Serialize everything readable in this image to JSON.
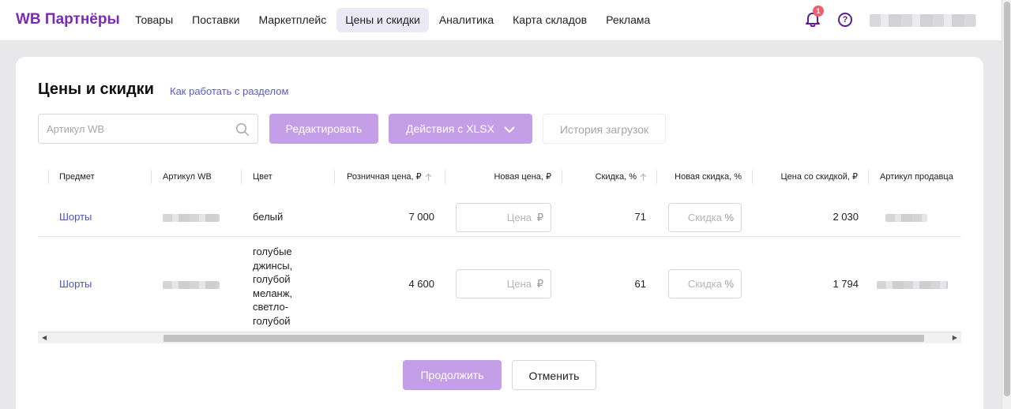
{
  "header": {
    "brand": "WB Партнёры",
    "nav": [
      "Товары",
      "Поставки",
      "Маркетплейс",
      "Цены и скидки",
      "Аналитика",
      "Карта складов",
      "Реклама"
    ],
    "active_nav": "Цены и скидки",
    "notification_count": "1",
    "help_glyph": "?"
  },
  "page": {
    "title": "Цены и скидки",
    "help_link": "Как работать с разделом"
  },
  "toolbar": {
    "search_placeholder": "Артикул WB",
    "edit_label": "Редактировать",
    "xlsx_label": "Действия с XLSX",
    "history_label": "История загрузок"
  },
  "table": {
    "columns": {
      "subject": "Предмет",
      "wb_article": "Артикул WB",
      "color": "Цвет",
      "retail_price": "Розничная цена, ₽",
      "new_price": "Новая цена, ₽",
      "discount": "Скидка, %",
      "new_discount": "Новая скидка, %",
      "discounted_price": "Цена со скидкой, ₽",
      "seller_article": "Артикул продавца"
    },
    "price_placeholder": "Цена",
    "price_suffix": "₽",
    "discount_placeholder": "Скидка",
    "discount_suffix": "%",
    "rows": [
      {
        "subject": "Шорты",
        "color": "белый",
        "retail_price": "7 000",
        "discount": "71",
        "discounted_price": "2 030"
      },
      {
        "subject": "Шорты",
        "color_lines": [
          "голубые",
          "джинсы,",
          "голубой",
          "меланж,",
          "светло-",
          "голубой"
        ],
        "retail_price": "4 600",
        "discount": "61",
        "discounted_price": "1 794"
      }
    ]
  },
  "footer": {
    "continue_label": "Продолжить",
    "cancel_label": "Отменить"
  },
  "colors": {
    "brand": "#7a2ab3",
    "primary_button": "#c49ee6",
    "link": "#4f4fc8"
  }
}
